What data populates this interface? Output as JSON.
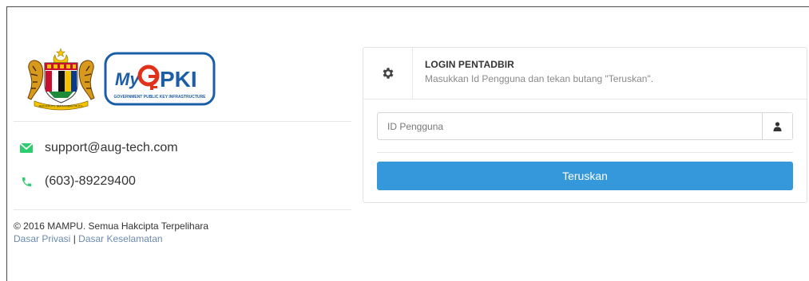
{
  "logos": {
    "crest_name": "Jata Negara Malaysia",
    "brand_text_my": "My",
    "brand_text_pki": "PKI",
    "brand_subtext": "GOVERNMENT PUBLIC KEY INFRASTRUCTURE"
  },
  "contact": {
    "email": "support@aug-tech.com",
    "phone": "(603)-89229400",
    "email_icon": "envelope-icon",
    "phone_icon": "phone-icon"
  },
  "footer": {
    "copyright": "© 2016 MAMPU. Semua Hakcipta Terpelihara",
    "privacy_link": "Dasar Privasi",
    "separator": " | ",
    "security_link": "Dasar Keselamatan"
  },
  "login_panel": {
    "icon": "gear-icon",
    "title": "LOGIN PENTADBIR",
    "subtitle": "Masukkan Id Pengguna dan tekan butang \"Teruskan\".",
    "username_placeholder": "ID Pengguna",
    "username_value": "",
    "user_icon": "user-icon",
    "submit_label": "Teruskan"
  },
  "colors": {
    "accent_button": "#3498db",
    "contact_icon_green": "#2ecc71",
    "link_color": "#6b8ab0"
  }
}
